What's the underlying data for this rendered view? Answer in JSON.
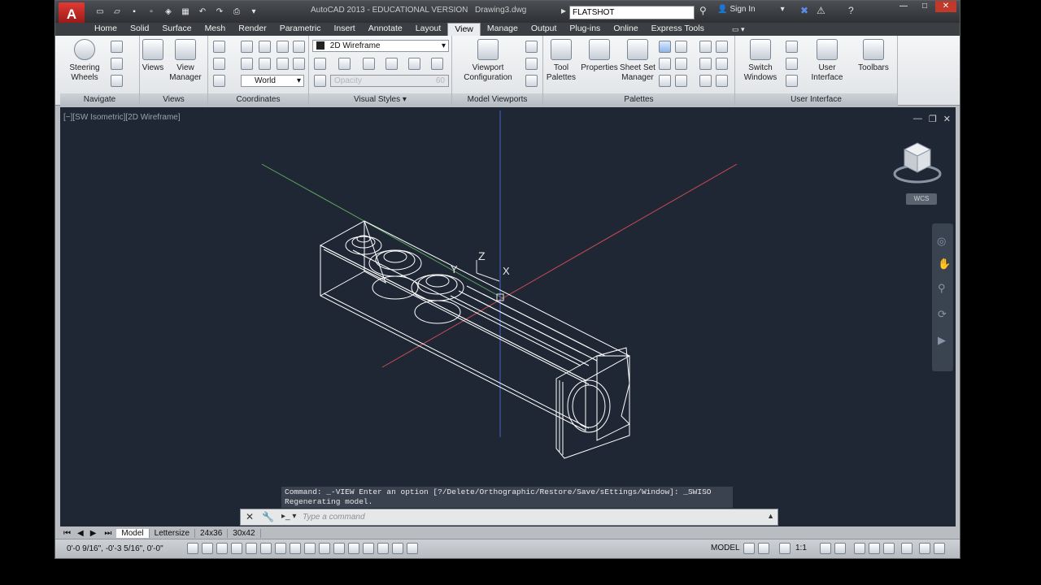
{
  "title": {
    "text": "AutoCAD 2013 - EDUCATIONAL VERSION",
    "document": "Drawing3.dwg",
    "search_value": "FLATSHOT",
    "sign_in": "Sign In",
    "logo": "A"
  },
  "tabs": [
    "Home",
    "Solid",
    "Surface",
    "Mesh",
    "Render",
    "Parametric",
    "Insert",
    "Annotate",
    "Layout",
    "View",
    "Manage",
    "Output",
    "Plug-ins",
    "Online",
    "Express Tools"
  ],
  "ribbon": {
    "navigate": {
      "title": "Navigate",
      "steering": "Steering Wheels"
    },
    "views": {
      "title": "Views",
      "views_btn": "Views",
      "view_manager": "View Manager"
    },
    "coordinates": {
      "title": "Coordinates",
      "ucs_value": "World"
    },
    "visual_styles": {
      "title": "Visual Styles",
      "style_value": "2D Wireframe",
      "opacity_label": "Opacity",
      "opacity_value": "60"
    },
    "model_viewports": {
      "title": "Model Viewports",
      "viewport_config": "Viewport Configuration"
    },
    "palettes": {
      "title": "Palettes",
      "tool_palettes": "Tool Palettes",
      "properties": "Properties",
      "sheet_set": "Sheet Set Manager"
    },
    "user_interface": {
      "title": "User Interface",
      "switch_windows": "Switch Windows",
      "user_interface": "User Interface",
      "toolbars": "Toolbars"
    }
  },
  "viewport": {
    "label": "[−][SW Isometric][2D Wireframe]",
    "axis_z": "Z",
    "axis_y": "Y",
    "axis_x": "X",
    "wcs": "WCS"
  },
  "command": {
    "history_1": "Command: _-VIEW Enter an option [?/Delete/Orthographic/Restore/Save/sEttings/Window]: _SWISO",
    "history_2": "Regenerating model.",
    "placeholder": "Type a command"
  },
  "layout_tabs": [
    "Model",
    "Lettersize",
    "24x36",
    "30x42"
  ],
  "status": {
    "coords": "0'-0 9/16\", -0'-3 5/16\", 0'-0\"",
    "model": "MODEL",
    "scale": "1:1"
  },
  "colors": {
    "viewport_bg": "#1f2734",
    "axis_red": "#c84a55",
    "axis_green": "#5fa65f",
    "axis_blue": "#4a63c8"
  }
}
